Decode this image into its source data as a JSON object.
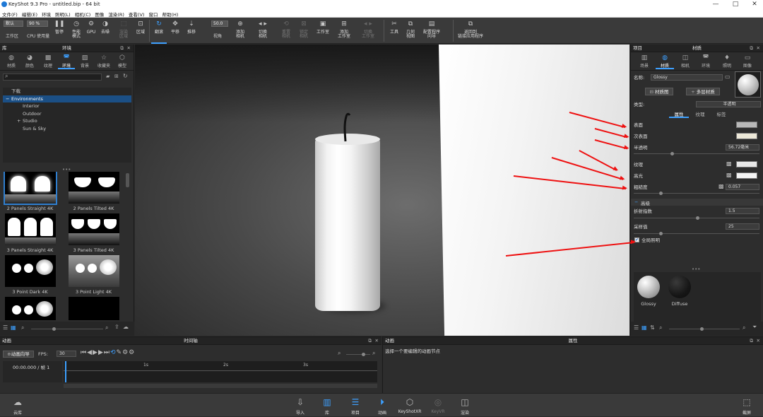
{
  "window": {
    "title": "KeyShot 9.3 Pro  - untitled.bip  - 64 bit",
    "min": "—",
    "max": "□",
    "close": "✕"
  },
  "menu": [
    "文件(F)",
    "编辑(E)",
    "环境",
    "照明(L)",
    "相机(C)",
    "图像",
    "渲染(R)",
    "查看(V)",
    "窗口",
    "帮助(H)"
  ],
  "toolbar": {
    "workspace_value": "默认",
    "workspace_label": "工作区",
    "cpu_value": "90 %",
    "cpu_label": "CPU 使用量",
    "pause": "暂停",
    "perf": "性能\n模式",
    "gpu": "GPU",
    "denoise": "去噪",
    "region": "渲染\n区域",
    "region_label": "区域",
    "tumble": "翻滚",
    "pan": "平移",
    "dolly": "推移",
    "fov_value": "50.0",
    "fov_label": "视角",
    "add_camera": "添加\n相机",
    "switch_camera": "切换\n相机",
    "reset_camera": "重置\n相机",
    "lock_camera": "锁定\n相机",
    "studio": "工作室",
    "add_studio": "添加\n工作室",
    "switch_studio": "切换\n工作室",
    "tools": "工具",
    "geometry_view": "几何\n视图",
    "config_wizard": "配置程序\n向导",
    "back_apply": "返回到\n链接应用程序"
  },
  "library": {
    "panel_title": "库",
    "subtitle": "环境",
    "tabs": [
      "材质",
      "颜色",
      "纹理",
      "环境",
      "背景",
      "收藏夹",
      "模型"
    ],
    "active_tab": 3,
    "tree": [
      {
        "label": "下载",
        "indent": 0,
        "prefix": ""
      },
      {
        "label": "Environments",
        "indent": 0,
        "prefix": "−",
        "selected": true
      },
      {
        "label": "Interior",
        "indent": 1,
        "prefix": ""
      },
      {
        "label": "Outdoor",
        "indent": 1,
        "prefix": ""
      },
      {
        "label": "Studio",
        "indent": 1,
        "prefix": "+"
      },
      {
        "label": "Sun & Sky",
        "indent": 1,
        "prefix": ""
      }
    ],
    "thumbnails": [
      {
        "label": "2 Panels Straight 4K",
        "kind": "panels2"
      },
      {
        "label": "2 Panels Tilted 4K",
        "kind": "tilted2"
      },
      {
        "label": "3 Panels Straight 4K",
        "kind": "panels3"
      },
      {
        "label": "3 Panels Tilted 4K",
        "kind": "tilted3"
      },
      {
        "label": "3 Point Dark 4K",
        "kind": "dots"
      },
      {
        "label": "3 Point Light 4K",
        "kind": "dotslight"
      },
      {
        "label": "",
        "kind": "dots"
      },
      {
        "label": "",
        "kind": "dark"
      }
    ]
  },
  "right_panel": {
    "title_left": "项目",
    "title": "材质",
    "tabs": [
      "场景",
      "材质",
      "相机",
      "环境",
      "照明",
      "图像"
    ],
    "active_tab": 1,
    "name_label": "名称:",
    "name_value": "Glossy",
    "material_graph_btn": "材质图",
    "multi_material_btn": "多层材质",
    "type_label": "类型:",
    "type_value": "半透明",
    "subtabs": [
      "属性",
      "纹理",
      "标签"
    ],
    "props": {
      "surface": "表面",
      "subsurface": "次表面",
      "translucency": "半透明",
      "translucency_value": "56.72毫米",
      "texture": "纹理",
      "specular": "高光",
      "roughness": "粗糙度",
      "roughness_value": "0.057",
      "advanced": "高级",
      "ior": "折射指数",
      "ior_value": "1.5",
      "samples": "采样值",
      "samples_value": "25",
      "gi": "全局照明"
    },
    "surface_color": "#b8b8b8",
    "subsurface_color": "#ece8d8",
    "texture_color": "#e8e8e8",
    "specular_color": "#f4f4f4",
    "materials": [
      "Glossy",
      "Diffuse"
    ]
  },
  "timeline": {
    "anim_title": "动画",
    "title": "时间轴",
    "anim_wizard": "动画向导",
    "fps_label": "FPS:",
    "fps_value": "30",
    "time": "00:00.000 / 帧 1",
    "ticks": [
      "1s",
      "2s",
      "3s"
    ]
  },
  "animation_props": {
    "title_left": "动画",
    "title": "属性",
    "hint": "选择一个要编辑的动画节点"
  },
  "bottom": {
    "cloud": "云库",
    "import": "导入",
    "library": "库",
    "project": "项目",
    "animation": "动画",
    "keyshotxr": "KeyShotXR",
    "keyvr": "KeyVR",
    "render": "渲染",
    "screenshot": "截屏"
  },
  "accent": "#3da0ff"
}
